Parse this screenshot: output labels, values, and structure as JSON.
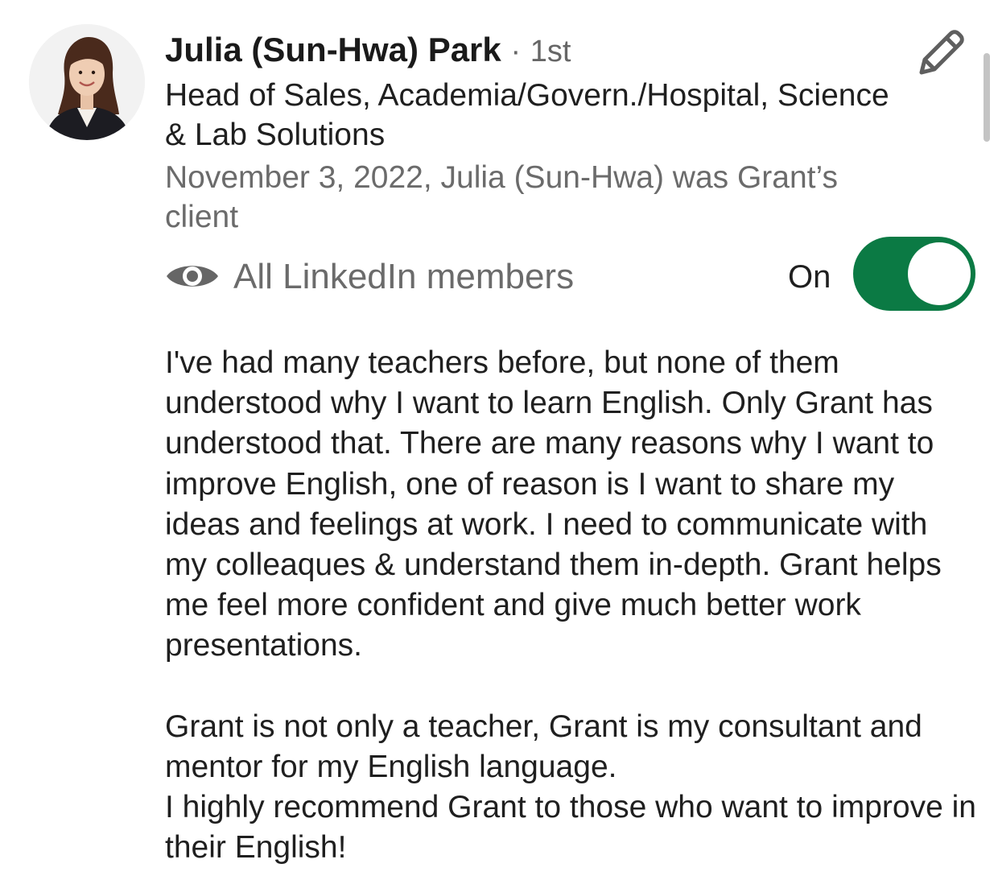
{
  "recommendation": {
    "author_name": "Julia (Sun-Hwa) Park",
    "separator": "·",
    "connection_degree": "1st",
    "headline": "Head of Sales, Academia/Govern./Hospital, Science & Lab Solutions",
    "relationship": "November 3, 2022, Julia (Sun-Hwa) was Grant’s client",
    "avatar_icon": "profile-photo",
    "edit_icon": "pencil-icon"
  },
  "visibility": {
    "icon": "eye-icon",
    "label": "All LinkedIn members",
    "toggle_state_label": "On",
    "toggle_on": true,
    "toggle_color": "#0b7a44"
  },
  "body": {
    "paragraph_1": "I've had many teachers before, but none of them understood why I want to learn English. Only Grant has understood that. There are many reasons why I want to improve English, one of reason is I want to share my ideas and feelings at work. I need to communicate with my colleaques & understand them in-depth. Grant helps me feel more confident and give much better work presentations.",
    "paragraph_2": "Grant is not only a teacher, Grant is my consultant and mentor for my English language.",
    "paragraph_3": "I highly recommend Grant to those who want to improve in their English!"
  }
}
